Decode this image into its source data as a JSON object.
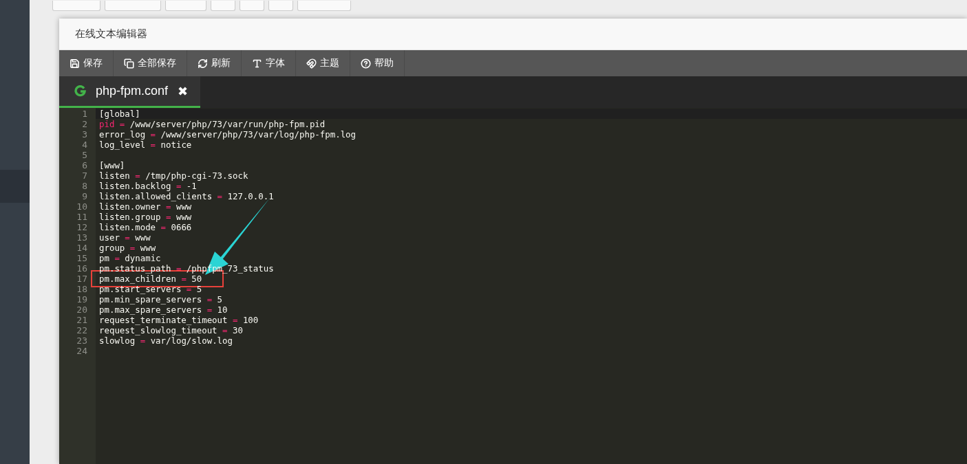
{
  "dialog": {
    "title": "在线文本编辑器",
    "toolbar": [
      {
        "kind": "save",
        "label": "保存"
      },
      {
        "kind": "save-all",
        "label": "全部保存"
      },
      {
        "kind": "refresh",
        "label": "刷新"
      },
      {
        "kind": "font",
        "label": "字体"
      },
      {
        "kind": "theme",
        "label": "主题"
      },
      {
        "kind": "help",
        "label": "帮助"
      }
    ],
    "tabs": [
      {
        "label": "php-fpm.conf",
        "close": "✖",
        "selected": true
      }
    ],
    "lines": [
      {
        "number": "1",
        "kind": "section",
        "text": "[global]",
        "marked": false
      },
      {
        "number": "2",
        "kind": "pair",
        "key": "pid",
        "operator": "=",
        "value": "/www/server/php/73/var/run/php-fpm.pid",
        "keyword": true,
        "marked": false
      },
      {
        "number": "3",
        "kind": "pair",
        "key": "error_log",
        "operator": "=",
        "value": "/www/server/php/73/var/log/php-fpm.log",
        "keyword": false,
        "marked": false
      },
      {
        "number": "4",
        "kind": "pair",
        "key": "log_level",
        "operator": "=",
        "value": "notice",
        "keyword": false,
        "marked": false
      },
      {
        "number": "5",
        "kind": "blank",
        "marked": false
      },
      {
        "number": "6",
        "kind": "section",
        "text": "[www]",
        "marked": false
      },
      {
        "number": "7",
        "kind": "pair",
        "key": "listen",
        "operator": "=",
        "value": "/tmp/php-cgi-73.sock",
        "keyword": false,
        "marked": false
      },
      {
        "number": "8",
        "kind": "pair",
        "key": "listen.backlog",
        "operator": "=",
        "value": "-1",
        "keyword": false,
        "marked": false
      },
      {
        "number": "9",
        "kind": "pair",
        "key": "listen.allowed_clients",
        "operator": "=",
        "value": "127.0.0.1",
        "keyword": false,
        "marked": false
      },
      {
        "number": "10",
        "kind": "pair",
        "key": "listen.owner",
        "operator": "=",
        "value": "www",
        "keyword": false,
        "marked": false
      },
      {
        "number": "11",
        "kind": "pair",
        "key": "listen.group",
        "operator": "=",
        "value": "www",
        "keyword": false,
        "marked": false
      },
      {
        "number": "12",
        "kind": "pair",
        "key": "listen.mode",
        "operator": "=",
        "value": "0666",
        "keyword": false,
        "marked": false
      },
      {
        "number": "13",
        "kind": "pair",
        "key": "user",
        "operator": "=",
        "value": "www",
        "keyword": false,
        "marked": false
      },
      {
        "number": "14",
        "kind": "pair",
        "key": "group",
        "operator": "=",
        "value": "www",
        "keyword": false,
        "marked": false
      },
      {
        "number": "15",
        "kind": "pair",
        "key": "pm",
        "operator": "=",
        "value": "dynamic",
        "keyword": false,
        "marked": false
      },
      {
        "number": "16",
        "kind": "pair",
        "key": "pm.status_path",
        "operator": "=",
        "value": "/phpfpm_73_status",
        "keyword": false,
        "marked": false
      },
      {
        "number": "17",
        "kind": "pair",
        "key": "pm.max_children",
        "operator": "=",
        "value": "50",
        "keyword": false,
        "marked": true
      },
      {
        "number": "18",
        "kind": "pair",
        "key": "pm.start_servers",
        "operator": "=",
        "value": "5",
        "keyword": false,
        "marked": false
      },
      {
        "number": "19",
        "kind": "pair",
        "key": "pm.min_spare_servers",
        "operator": "=",
        "value": "5",
        "keyword": false,
        "marked": false
      },
      {
        "number": "20",
        "kind": "pair",
        "key": "pm.max_spare_servers",
        "operator": "=",
        "value": "10",
        "keyword": false,
        "marked": false
      },
      {
        "number": "21",
        "kind": "pair",
        "key": "request_terminate_timeout",
        "operator": "=",
        "value": "100",
        "keyword": false,
        "marked": false
      },
      {
        "number": "22",
        "kind": "pair",
        "key": "request_slowlog_timeout",
        "operator": "=",
        "value": "30",
        "keyword": false,
        "marked": false
      },
      {
        "number": "23",
        "kind": "pair",
        "key": "slowlog",
        "operator": "=",
        "value": "var/log/slow.log",
        "keyword": false,
        "marked": false
      },
      {
        "number": "24",
        "kind": "blank",
        "marked": false
      }
    ]
  }
}
